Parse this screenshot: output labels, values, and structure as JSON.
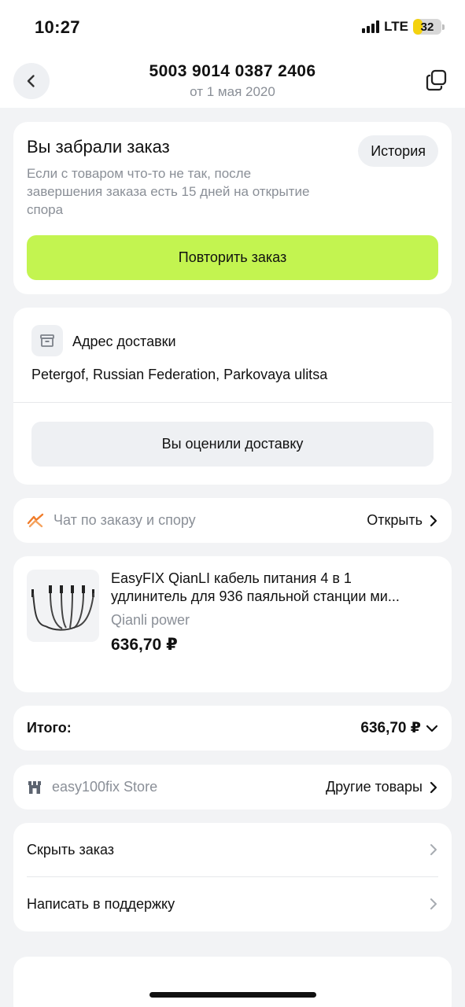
{
  "status_bar": {
    "time": "10:27",
    "network": "LTE",
    "battery": "32",
    "battery_level": 0.32
  },
  "header": {
    "order_number": "5003 9014 0387 2406",
    "date": "от 1 мая 2020",
    "back_icon": "chevron-left-icon",
    "copy_icon": "copy-icon"
  },
  "order_status": {
    "title": "Вы забрали заказ",
    "description": "Если с товаром что-то не так, после завершения заказа есть 15 дней на открытие спора",
    "history_label": "История",
    "repeat_label": "Повторить заказ"
  },
  "delivery": {
    "label": "Адрес доставки",
    "address": "Petergof, Russian Federation, Parkovaya ulitsa",
    "rated_label": "Вы оценили доставку"
  },
  "chat": {
    "label": "Чат по заказу и спору",
    "open_label": "Открыть"
  },
  "product": {
    "title_line1": "EasyFIX QianLI кабель питания 4 в 1",
    "title_line2": "удлинитель для 936 паяльной станции ми...",
    "brand": "Qianli power",
    "price": "636,70 ₽"
  },
  "total": {
    "label": "Итого:",
    "value": "636,70 ₽"
  },
  "store": {
    "name": "easy100fix Store",
    "other_label": "Другие товары"
  },
  "actions": {
    "hide_label": "Скрыть заказ",
    "support_label": "Написать в поддержку"
  },
  "colors": {
    "accent": "#c3f450",
    "background": "#f2f3f5",
    "muted_text": "#8a8f97",
    "chat_icon": "#f07c2a"
  }
}
